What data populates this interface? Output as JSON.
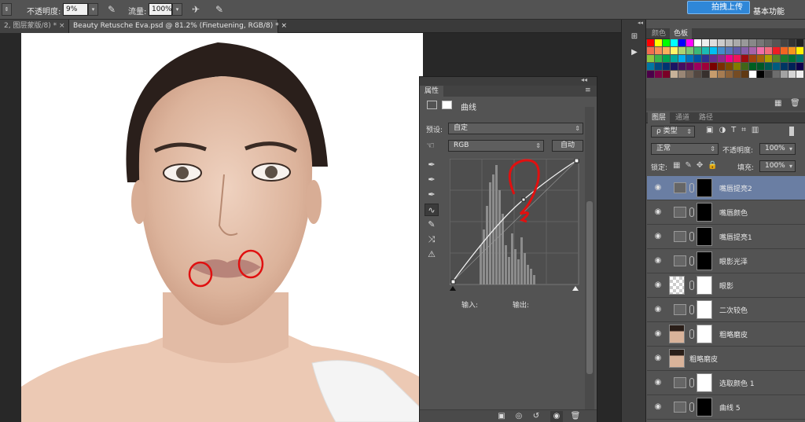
{
  "options_bar": {
    "opacity_label": "不透明度:",
    "opacity_value": "9%",
    "flow_label": "流量:",
    "flow_value": "100%",
    "upload_label": "拍拽上传",
    "workspace_label": "基本功能"
  },
  "doc_tabs": [
    {
      "label": "2, 图层蒙版/8) *"
    },
    {
      "label": "Beauty Retusche Eva.psd @ 81.2% (Finetuening, RGB/8) *"
    }
  ],
  "properties": {
    "tab_label": "属性",
    "type_label": "曲线",
    "preset_label": "预设:",
    "preset_value": "自定",
    "channel_value": "RGB",
    "auto_label": "自动",
    "input_label": "输入:",
    "output_label": "输出:"
  },
  "right_panels": {
    "color_tabs": [
      "颜色",
      "色板"
    ],
    "layer_tabs": [
      "图层",
      "通道",
      "路径"
    ],
    "filter_label": "ρ 类型",
    "blend_mode": "正常",
    "opacity_label": "不透明度:",
    "opacity_value": "100%",
    "lock_label": "锁定:",
    "fill_label": "填充:",
    "fill_value": "100%"
  },
  "layers": [
    {
      "name": "嘴唇提亮2",
      "kind": "curves",
      "mask": "black",
      "selected": true
    },
    {
      "name": "嘴唇颜色",
      "kind": "levels",
      "mask": "black",
      "selected": false
    },
    {
      "name": "嘴唇提亮1",
      "kind": "curves",
      "mask": "black",
      "selected": false
    },
    {
      "name": "眼影光泽",
      "kind": "curves",
      "mask": "black",
      "selected": false
    },
    {
      "name": "眼影",
      "kind": "empty",
      "mask": "white",
      "selected": false
    },
    {
      "name": "二次较色",
      "kind": "levels",
      "mask": "white",
      "selected": false
    },
    {
      "name": "粗略磨皮",
      "kind": "photo",
      "mask": "white",
      "selected": false
    },
    {
      "name": "粗略磨皮",
      "kind": "photo-only",
      "mask": "",
      "selected": false
    },
    {
      "name": "选取颜色 1",
      "kind": "levels",
      "mask": "white",
      "selected": false
    },
    {
      "name": "曲线 5",
      "kind": "curves",
      "mask": "black",
      "selected": false
    }
  ],
  "colors": {
    "accent": "#2f87d8",
    "selected_layer": "#6a7ea3",
    "annotation": "#e01010"
  }
}
